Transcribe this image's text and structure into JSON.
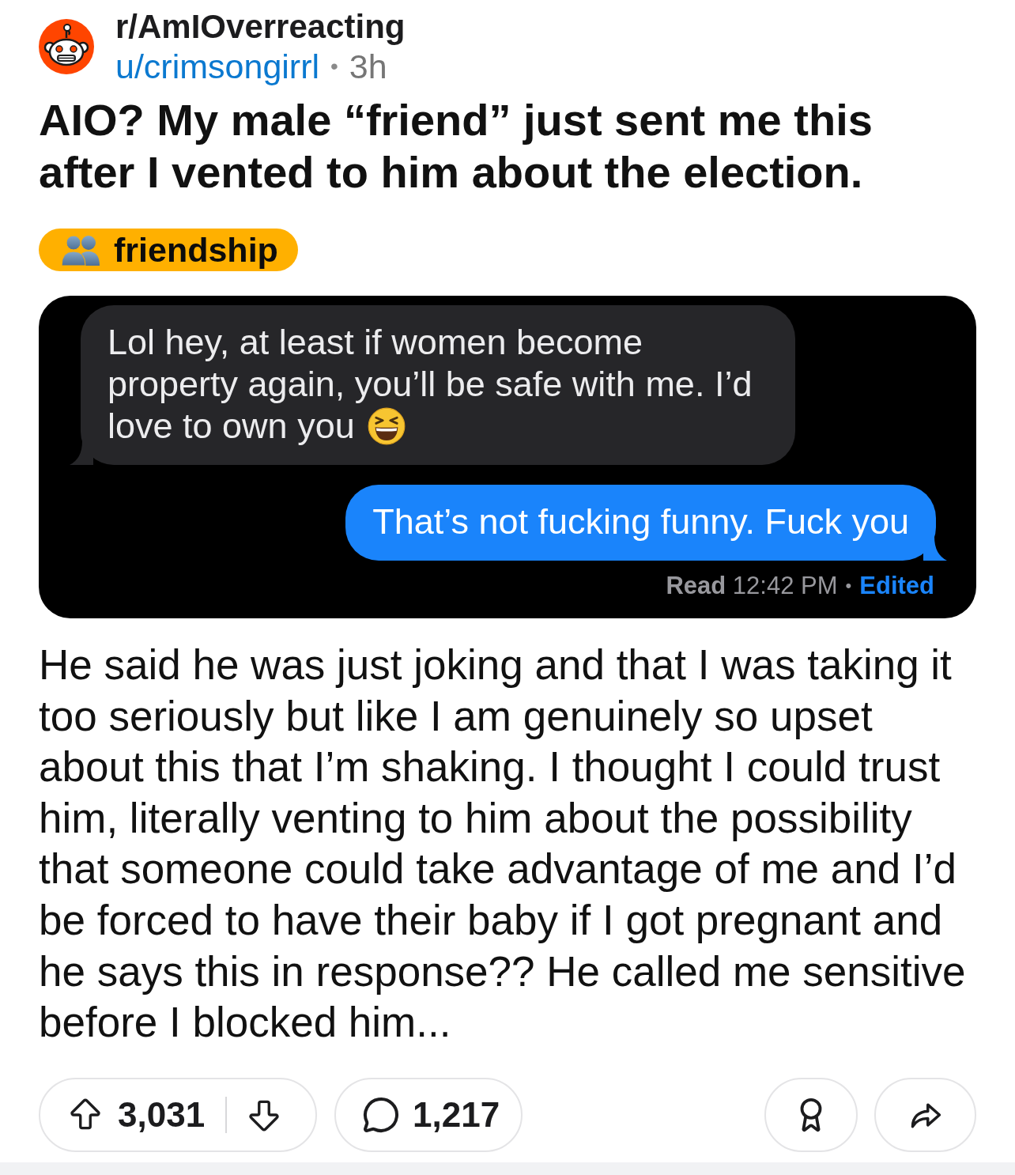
{
  "post": {
    "subreddit": "r/AmIOverreacting",
    "author": "u/crimsongirrl",
    "separator": "•",
    "age": "3h",
    "title": "AIO? My male “friend” just sent me this after I vented to him about the election.",
    "flair": "friendship"
  },
  "screenshot": {
    "messages": [
      {
        "kind": "received",
        "text": "Lol hey, at least if women become property again, you’ll be safe with me. I’d love to own you",
        "emoji": true
      },
      {
        "kind": "sent",
        "text": "That’s not fucking funny. Fuck you",
        "emoji": false
      }
    ],
    "receipt": {
      "status": "Read",
      "time": "12:42 PM",
      "separator": "•",
      "note": "Edited"
    }
  },
  "body": "He said he was just joking and that I was taking it too seriously but like I am genuinely so upset about this that I’m shaking. I thought I could trust him, literally venting to him about the possibility that someone could take advantage of me and I’d be forced to have their baby if I got pregnant and he says this in response?? He called me sensitive before I blocked him...",
  "actions": {
    "score": "3,031",
    "comments": "1,217"
  }
}
